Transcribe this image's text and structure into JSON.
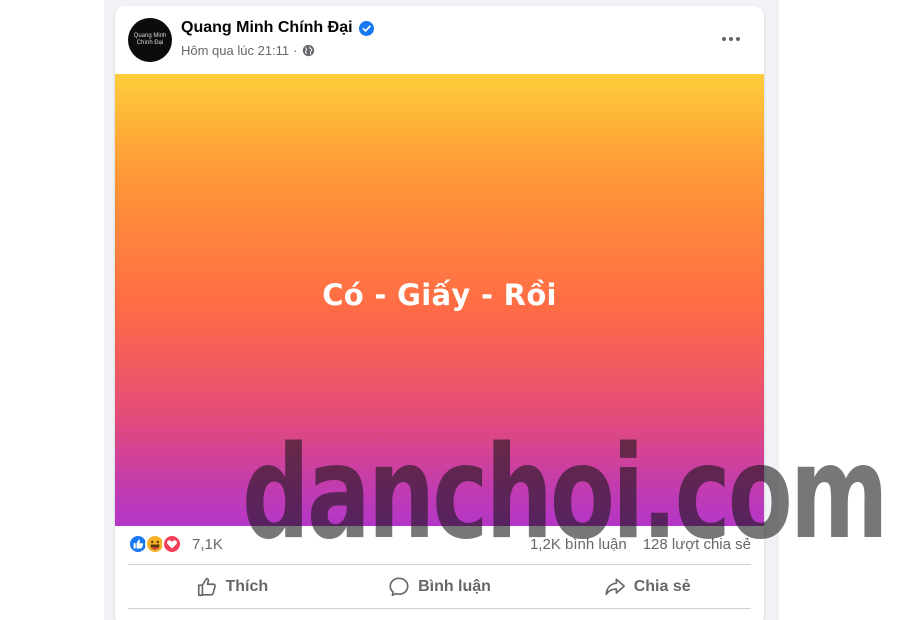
{
  "post": {
    "author": "Quang Minh Chính Đại",
    "avatar_text": [
      "Quang Minh",
      "Chính Đại"
    ],
    "timestamp": "Hôm qua lúc 21:11",
    "separator": "·",
    "audience_icon": "globe-icon",
    "verified_icon": "verified-badge-icon",
    "more_icon": "more-options-icon",
    "text": "Có - Giấy - Rồi",
    "background_gradient": [
      "#fecd3a",
      "#ff6b45",
      "#b436c7"
    ]
  },
  "stats": {
    "reaction_icons": [
      "like-icon",
      "haha-icon",
      "love-icon"
    ],
    "reaction_count": "7,1K",
    "comments": "1,2K bình luận",
    "shares": "128 lượt chia sẻ"
  },
  "actions": {
    "like": "Thích",
    "comment": "Bình luận",
    "share": "Chia sẻ"
  },
  "watermark": "danchoi.com",
  "colors": {
    "facebook_blue": "#1877f2",
    "secondary_text": "#65676b",
    "card_bg": "#ffffff",
    "feed_bg": "#f0f2f5"
  }
}
